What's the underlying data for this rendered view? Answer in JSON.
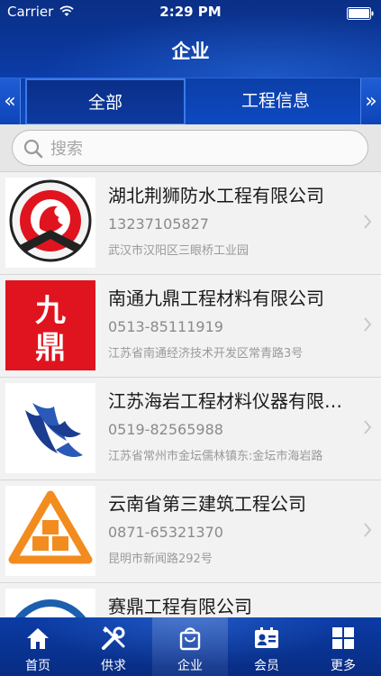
{
  "status_bar": {
    "carrier": "Carrier",
    "time": "2:29 PM"
  },
  "header": {
    "title": "企业"
  },
  "tabs": {
    "left_arrow": "«",
    "right_arrow": "»",
    "items": [
      "全部",
      "工程信息"
    ]
  },
  "search": {
    "placeholder": "搜索"
  },
  "companies": [
    {
      "name": "湖北荆狮防水工程有限公司",
      "phone": "13237105827",
      "address": "武汉市汉阳区三眼桥工业园"
    },
    {
      "name": "南通九鼎工程材料有限公司",
      "phone": "0513-85111919",
      "address": "江苏省南通经济技术开发区常青路3号"
    },
    {
      "name": "江苏海岩工程材料仪器有限公司",
      "phone": "0519-82565988",
      "address": "江苏省常州市金坛儒林镇东:金坛市海岩路"
    },
    {
      "name": "云南省第三建筑工程公司",
      "phone": "0871-65321370",
      "address": "昆明市新闻路292号"
    },
    {
      "name": "赛鼎工程有限公司",
      "phone": "",
      "address": ""
    }
  ],
  "logos": {
    "logo1_text": "九\n鼎"
  },
  "tabbar": {
    "items": [
      "首页",
      "供求",
      "企业",
      "会员",
      "更多"
    ],
    "active_index": 2
  },
  "colors": {
    "header_blue": "#0b3aa3",
    "accent_red": "#e0141e",
    "orange": "#f28c1e",
    "navy": "#1b3c8f"
  }
}
